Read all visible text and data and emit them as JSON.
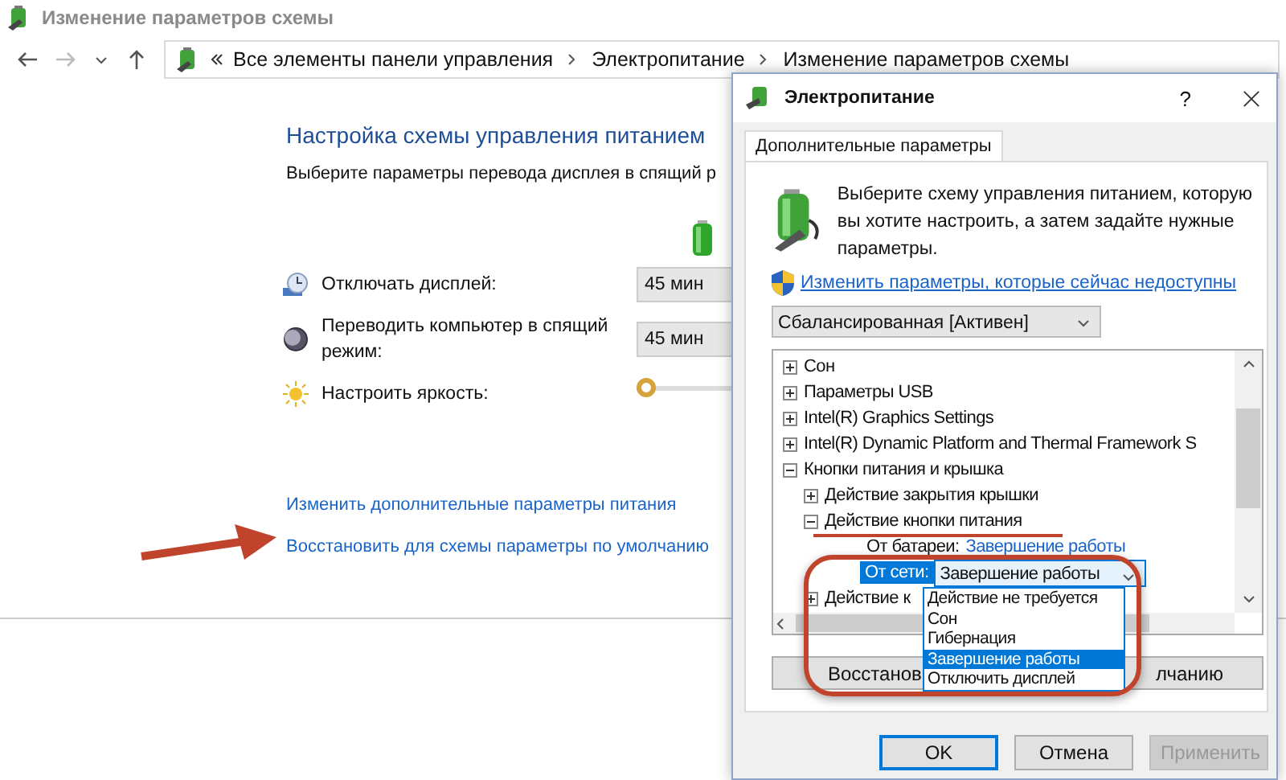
{
  "window": {
    "title": "Изменение параметров схемы"
  },
  "breadcrumb": [
    "Все элементы панели управления",
    "Электропитание",
    "Изменение параметров схемы"
  ],
  "heading": "Настройка схемы управления питанием",
  "subtitle": "Выберите параметры перевода дисплея в спящий р",
  "settings": [
    {
      "kind": "select",
      "label": "Отключать дисплей:",
      "value": "45 мин"
    },
    {
      "kind": "select",
      "label": "Переводить компьютер в спящий режим:",
      "value": "45 мин"
    },
    {
      "kind": "slider",
      "label": "Настроить яркость:",
      "level": 0
    }
  ],
  "links": [
    "Изменить дополнительные параметры питания",
    "Восстановить для схемы параметры по умолчанию"
  ],
  "dialog": {
    "title": "Электропитание",
    "help": "?",
    "tab": {
      "label": "Дополнительные параметры",
      "selected": true
    },
    "description": "Выберите схему управления питанием, которую вы хотите настроить, а затем задайте нужные параметры.",
    "admin_link": "Изменить параметры, которые сейчас недоступны",
    "scheme": "Сбалансированная [Активен]",
    "tree": [
      {
        "label": "Сон",
        "expanded": false
      },
      {
        "label": "Параметры USB",
        "expanded": false
      },
      {
        "label": "Intel(R) Graphics Settings",
        "expanded": false
      },
      {
        "label": "Intel(R) Dynamic Platform and Thermal Framework S",
        "expanded": false
      },
      {
        "label": "Кнопки питания и крышка",
        "expanded": true,
        "children": [
          {
            "label": "Действие закрытия крышки",
            "expanded": false
          },
          {
            "label": "Действие кнопки питания",
            "expanded": true,
            "children": [
              {
                "kind": "value",
                "label": "От батареи:",
                "value": "Завершение работы"
              },
              {
                "kind": "select",
                "label": "От сети:",
                "value": "Завершение работы",
                "options": [
                  {
                    "label": "Действие не требуется",
                    "selected": false
                  },
                  {
                    "label": "Сон",
                    "selected": false
                  },
                  {
                    "label": "Гибернация",
                    "selected": false
                  },
                  {
                    "label": "Завершение работы",
                    "selected": true
                  },
                  {
                    "label": "Отключить дисплей",
                    "selected": false
                  }
                ]
              }
            ]
          },
          {
            "label": "Действие к",
            "expanded": false
          }
        ]
      }
    ],
    "restore_button": [
      "Восстанов",
      "лчанию"
    ],
    "buttons": [
      {
        "label": "OK",
        "disabled": false
      },
      {
        "label": "Отмена",
        "disabled": false
      },
      {
        "label": "Применить",
        "disabled": true
      }
    ]
  }
}
